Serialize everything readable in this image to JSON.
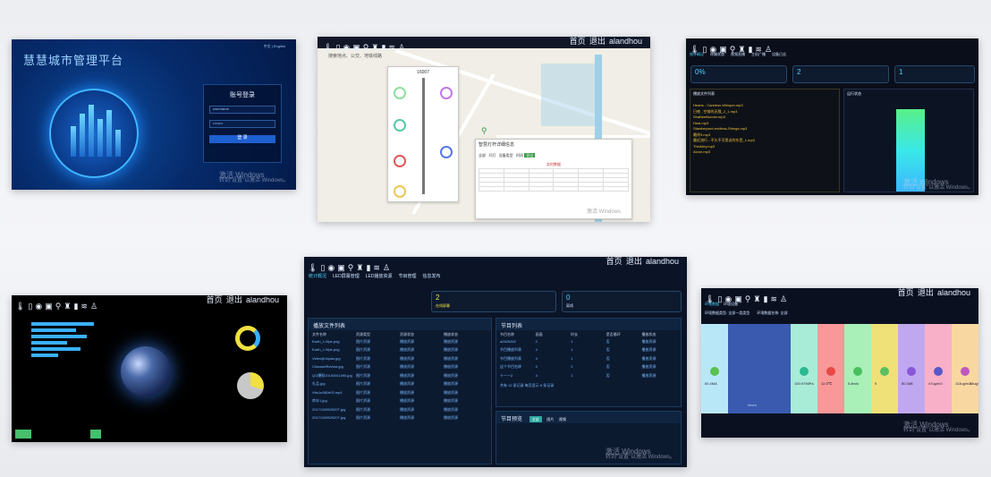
{
  "icons": [
    "temperature-icon",
    "screen-icon",
    "camera-icon",
    "pump-icon",
    "location-icon",
    "light-icon",
    "chart-icon",
    "wifi-icon",
    "person-icon"
  ],
  "panel1": {
    "title": "慧慧城市管理平台",
    "lang": "中文 | English",
    "login_title": "账号登录",
    "username": "username",
    "password": "••••••••",
    "login_btn": "登 录",
    "wm1": "激活 Windows",
    "wm2": "转到“设置”以激活 Windows。"
  },
  "panel2": {
    "search": "搜索地点、公交、地铁线路",
    "pole_id": "16007",
    "card_title": "智慧灯杆详细信息",
    "export": "导出",
    "radio": [
      "全部",
      "开灯",
      "设备类型",
      "时间"
    ],
    "sub_title": "实时数据",
    "wm": "激活 Windows",
    "home": "首页",
    "out": "退出",
    "user": "alandhou"
  },
  "panel3": {
    "nav": [
      "统计概况",
      "终端状态",
      "视频直播",
      "主机广播",
      "设备日志"
    ],
    "stats": [
      "0%",
      "2",
      "1"
    ],
    "list_title": "播放文件列表",
    "chart_title": "运行状态",
    "files": [
      "Hearts - Careless Whisper.mp3",
      "日夜 - 空前的无限_2_1.mp3",
      "ShaBeeBonder.mp3",
      "Heal.mp3",
      "Starsbeyond-endless-Strings.mp3",
      "最终3.mp3",
      "最近流行 - 不久不可思议的东西_1.mp3",
      "TheAlley.mp3",
      "Alone.mp3"
    ],
    "wm1": "激活 Windows",
    "wm2": "转到“设置”以激活 Windows。"
  },
  "panel4": {
    "home": "首页",
    "out": "退出",
    "user": "alandhou"
  },
  "panel5": {
    "nav": [
      "统计概况",
      "LED屏幕管理",
      "LED播放资源",
      "节目管理",
      "信息发布"
    ],
    "stat1_num": "2",
    "stat1_label": "在线屏幕",
    "stat2_num": "0",
    "stat2_label": "离线",
    "home": "首页",
    "out": "退出",
    "user": "alandhou",
    "res_title": "播放文件列表",
    "res_cols": [
      "文件名称",
      "资源类型",
      "资源状态",
      "播放状态"
    ],
    "res_rows": [
      [
        "Earth_1.0fps.png",
        "图片资源",
        "播放资源",
        "播放资源"
      ],
      [
        "Earth_1.0fps.png",
        "图片资源",
        "播放资源",
        "播放资源"
      ],
      [
        "Video@Japan.jpg",
        "图片资源",
        "播放资源",
        "播放资源"
      ],
      [
        "ChinaselReview.jpg",
        "图片资源",
        "播放资源",
        "播放资源"
      ],
      [
        "QG爆款20190911095.jpg",
        "图片资源",
        "播放资源",
        "播放资源"
      ],
      [
        "礼品.jpg",
        "图片资源",
        "播放资源",
        "播放资源"
      ],
      [
        "Vbs1u981b03.mp4",
        "图片资源",
        "播放资源",
        "播放资源"
      ],
      [
        "库存1.jpg",
        "图片资源",
        "播放资源",
        "播放资源"
      ],
      [
        "20171199525207.jpg",
        "图片资源",
        "播放资源",
        "播放资源"
      ],
      [
        "20171199525207.jpg",
        "图片资源",
        "播放资源",
        "播放资源"
      ]
    ],
    "prog_title": "节目列表",
    "prog_cols": [
      "节目名称",
      "画面",
      "时长",
      "是否循环",
      "播放状态"
    ],
    "prog_rows": [
      [
        "a2626262",
        "2",
        "1",
        "否",
        "播放资源"
      ],
      [
        "节目播放列表",
        "4",
        "1",
        "否",
        "播放资源"
      ],
      [
        "节目播放列表",
        "4",
        "1",
        "否",
        "播放资源"
      ],
      [
        "这个节目名称",
        "2",
        "2",
        "否",
        "播放资源"
      ],
      [
        "十一一2",
        "4",
        "1",
        "否",
        "播放资源"
      ]
    ],
    "pager": "共有 12 条记录 每页显示 5 条记录",
    "preview_title": "节目预览",
    "preview_tabs": [
      "全部",
      "图片",
      "视频"
    ],
    "wm1": "激活 Windows",
    "wm2": "转到“设置”以激活 Windows。"
  },
  "panel6": {
    "tabs": [
      "环境数据",
      "环境设备"
    ],
    "filters": [
      "环境数据类型: 全部一类类型",
      "环境数据名称: 全部"
    ],
    "home": "首页",
    "out": "退出",
    "user": "alandhou",
    "vals": [
      "60.4MA",
      "100.9798Pa",
      "12.5℃",
      "0.8m/s",
      "9",
      "80.3dB",
      "47ug/m3",
      "113ug/m3",
      "38ug/m3"
    ],
    "mid": "0ecm",
    "wm1": "激活 Windows",
    "wm2": "转到“设置”以激活 Windows。"
  }
}
